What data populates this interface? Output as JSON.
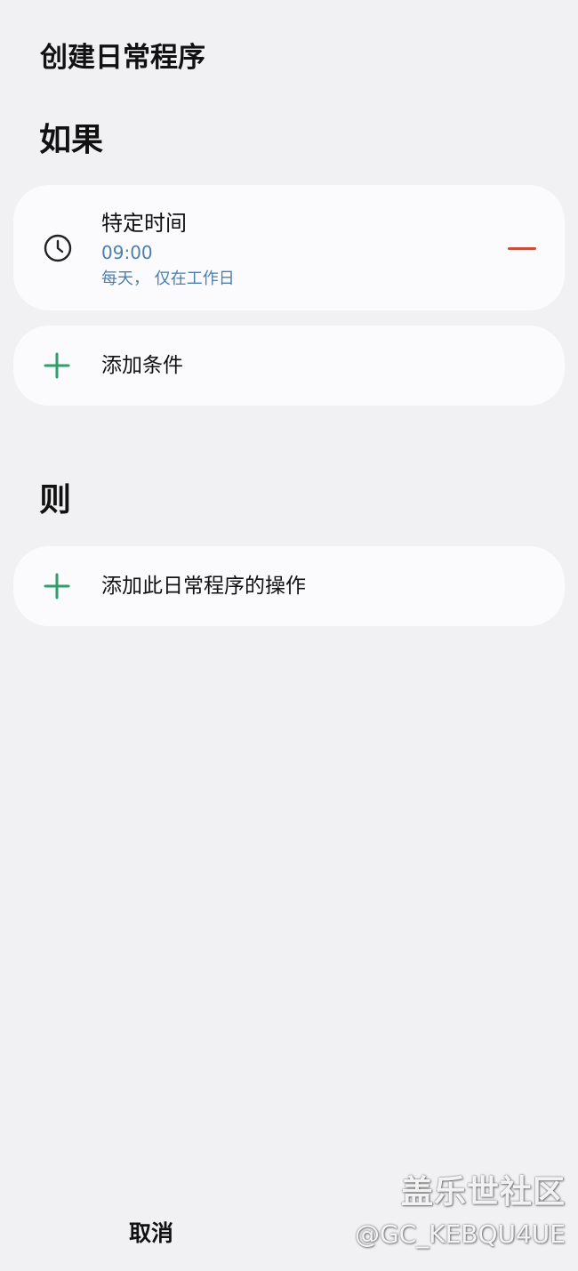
{
  "page": {
    "title": "创建日常程序"
  },
  "if_section": {
    "title": "如果",
    "condition": {
      "icon": "clock-icon",
      "title": "特定时间",
      "time": "09:00",
      "days": "每天， 仅在工作日",
      "remove_icon": "minus-icon"
    },
    "add_condition": {
      "icon": "plus-icon",
      "label": "添加条件"
    }
  },
  "then_section": {
    "title": "则",
    "add_action": {
      "icon": "plus-icon",
      "label": "添加此日常程序的操作"
    }
  },
  "footer": {
    "cancel_label": "取消"
  },
  "watermark": {
    "brand": "盖乐世社区",
    "user": "@GC_KEBQU4UE"
  },
  "colors": {
    "background": "#f1f1f4",
    "card": "#fbfbfd",
    "accent_blue": "#4a7fb0",
    "accent_green": "#2e9e6b",
    "remove_red": "#c9503d"
  }
}
